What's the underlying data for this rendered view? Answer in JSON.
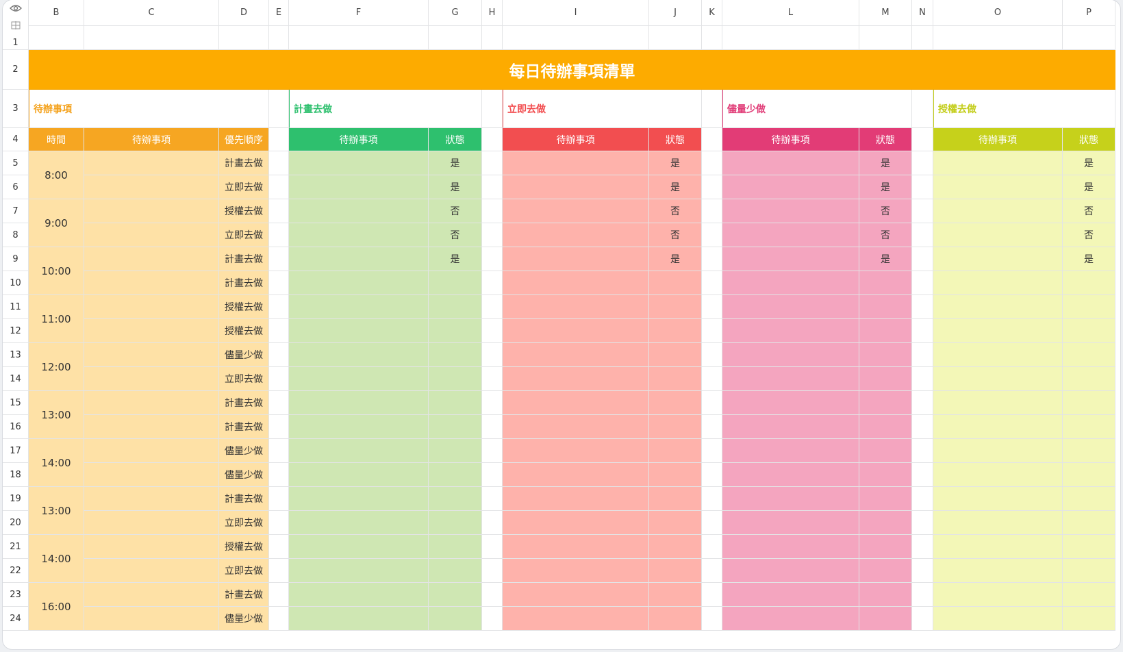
{
  "columns": [
    {
      "letter": "B",
      "w": 81
    },
    {
      "letter": "C",
      "w": 197
    },
    {
      "letter": "D",
      "w": 73
    },
    {
      "letter": "E",
      "w": 29
    },
    {
      "letter": "F",
      "w": 204
    },
    {
      "letter": "G",
      "w": 78
    },
    {
      "letter": "H",
      "w": 30
    },
    {
      "letter": "I",
      "w": 214
    },
    {
      "letter": "J",
      "w": 77
    },
    {
      "letter": "K",
      "w": 30
    },
    {
      "letter": "L",
      "w": 200
    },
    {
      "letter": "M",
      "w": 77
    },
    {
      "letter": "N",
      "w": 31
    },
    {
      "letter": "O",
      "w": 189
    },
    {
      "letter": "P",
      "w": 77
    }
  ],
  "corner_row_label": "1",
  "rows_extra": [
    "2",
    "3",
    "4",
    "5",
    "6",
    "7",
    "8",
    "9",
    "10",
    "11",
    "12",
    "13",
    "14",
    "15",
    "16",
    "17",
    "18",
    "19",
    "20",
    "21",
    "22",
    "23",
    "24"
  ],
  "title": "每日待辦事項清單",
  "sections": [
    {
      "label": "待辦事項",
      "color": "#f4a21d",
      "start": 0,
      "span": 3
    },
    {
      "label": "計畫去做",
      "color": "#2ec06e",
      "start": 4,
      "span": 2
    },
    {
      "label": "立即去做",
      "color": "#f24e50",
      "start": 7,
      "span": 2
    },
    {
      "label": "儘量少做",
      "color": "#e13f79",
      "start": 10,
      "span": 2
    },
    {
      "label": "授權去做",
      "color": "#c3cd1a",
      "start": 13,
      "span": 2
    }
  ],
  "headers": [
    {
      "label": "時間",
      "col": 0,
      "bg": "#f6a622"
    },
    {
      "label": "待辦事項",
      "col": 1,
      "bg": "#f6a622"
    },
    {
      "label": "優先順序",
      "col": 2,
      "bg": "#f6a622"
    },
    {
      "label": "待辦事項",
      "col": 4,
      "bg": "#2ec06e"
    },
    {
      "label": "狀態",
      "col": 5,
      "bg": "#2ec06e"
    },
    {
      "label": "待辦事項",
      "col": 7,
      "bg": "#f24e50"
    },
    {
      "label": "狀態",
      "col": 8,
      "bg": "#f24e50"
    },
    {
      "label": "待辦事項",
      "col": 10,
      "bg": "#e23c76"
    },
    {
      "label": "狀態",
      "col": 11,
      "bg": "#e23c76"
    },
    {
      "label": "待辦事項",
      "col": 13,
      "bg": "#c6d11b"
    },
    {
      "label": "狀態",
      "col": 14,
      "bg": "#c6d11b"
    }
  ],
  "fills": {
    "left": "#fee1a6",
    "plan": "#cfe7b3",
    "now": "#feb2ab",
    "less": "#f4a5bf",
    "delegate": "#f3f7b7"
  },
  "times": [
    "8:00",
    "9:00",
    "10:00",
    "11:00",
    "12:00",
    "13:00",
    "14:00",
    "13:00",
    "14:00",
    "16:00"
  ],
  "priorities": [
    "計畫去做",
    "立即去做",
    "授權去做",
    "立即去做",
    "計畫去做",
    "計畫去做",
    "授權去做",
    "授權去做",
    "儘量少做",
    "立即去做",
    "計畫去做",
    "計畫去做",
    "儘量少做",
    "儘量少做",
    "計畫去做",
    "立即去做",
    "授權去做",
    "立即去做",
    "計畫去做",
    "儘量少做"
  ],
  "status": [
    "是",
    "是",
    "否",
    "否",
    "是"
  ]
}
